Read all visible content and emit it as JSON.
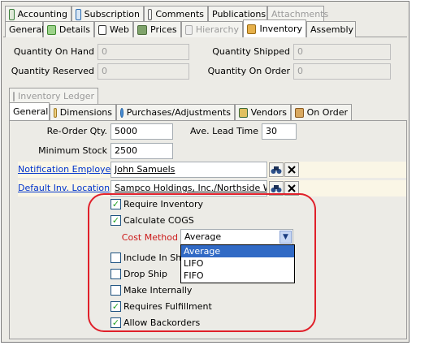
{
  "top_tabs": [
    {
      "label": "Accounting",
      "icon": "accounting-icon",
      "color": "#3a7d3a"
    },
    {
      "label": "Subscription",
      "icon": "subscription-icon",
      "color": "#2a6bb0"
    },
    {
      "label": "Comments",
      "icon": "comments-icon",
      "color": "#606060"
    },
    {
      "label": "Publications",
      "icon": "",
      "color": ""
    },
    {
      "label": "Attachments",
      "icon": "",
      "color": ""
    }
  ],
  "second_tabs": [
    {
      "label": "General",
      "icon": ""
    },
    {
      "label": "Details",
      "icon": "details-icon"
    },
    {
      "label": "Web",
      "icon": "web-icon"
    },
    {
      "label": "Prices",
      "icon": "prices-icon"
    },
    {
      "label": "Hierarchy",
      "icon": "hierarchy-icon"
    },
    {
      "label": "Inventory",
      "icon": "inventory-icon"
    },
    {
      "label": "Assembly",
      "icon": ""
    }
  ],
  "quantities": {
    "on_hand_label": "Quantity On Hand",
    "on_hand": "0",
    "reserved_label": "Quantity Reserved",
    "reserved": "0",
    "shipped_label": "Quantity Shipped",
    "shipped": "0",
    "on_order_label": "Quantity On Order",
    "on_order": "0"
  },
  "ledger_tab": "Inventory Ledger",
  "inner_tabs": [
    {
      "label": "General"
    },
    {
      "label": "Dimensions"
    },
    {
      "label": "Purchases/Adjustments"
    },
    {
      "label": "Vendors"
    },
    {
      "label": "On Order"
    }
  ],
  "form": {
    "reorder_label": "Re-Order Qty.",
    "reorder": "5000",
    "lead_label": "Ave. Lead Time",
    "lead": "30",
    "minstock_label": "Minimum Stock",
    "minstock": "2500",
    "notify_label": "Notification Employee",
    "notify": "John Samuels",
    "location_label": "Default Inv. Location",
    "location": "Sampco Holdings, Inc./Northside Warel"
  },
  "checks": {
    "require_inventory": "Require Inventory",
    "calculate_cogs": "Calculate COGS",
    "include_in_ship": "Include In Ship",
    "drop_ship": "Drop Ship",
    "make_internally": "Make Internally",
    "requires_fulfillment": "Requires Fulfillment",
    "allow_backorders": "Allow Backorders"
  },
  "cost_method": {
    "label": "Cost Method",
    "value": "Average",
    "options": [
      "Average",
      "LIFO",
      "FIFO"
    ]
  },
  "colors": {
    "highlight": "#e0202a",
    "link": "#0033cc",
    "select": "#316ac5"
  }
}
